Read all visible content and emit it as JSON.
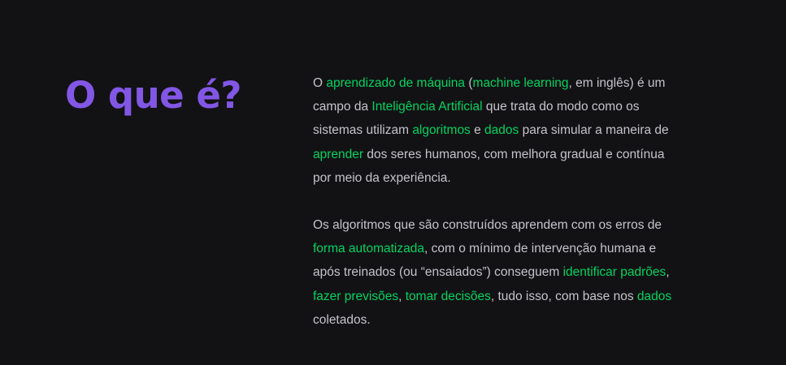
{
  "title": "O que é?",
  "accent_color": "#8257e5",
  "highlight_color": "#04d361",
  "paragraph1": [
    "O ",
    "aprendizado de máquina",
    " (",
    "machine learning",
    ", em inglês) é um campo da ",
    "Inteligência Artificial",
    " que trata do modo como os sistemas utilizam ",
    "algoritmos",
    " e ",
    "dados",
    " para simular a maneira de ",
    "aprender",
    " dos seres humanos, com melhora gradual e contínua por meio da experiência."
  ],
  "paragraph2": [
    "Os algoritmos que são construídos aprendem com os erros de ",
    "forma automatizada",
    ", com o mínimo de intervenção humana e após treinados (ou “ensaiados”) conseguem ",
    "identificar padrões",
    ", ",
    "fazer previsões",
    ", ",
    "tomar decisões",
    ", tudo isso, com base nos ",
    "dados",
    " coletados."
  ]
}
